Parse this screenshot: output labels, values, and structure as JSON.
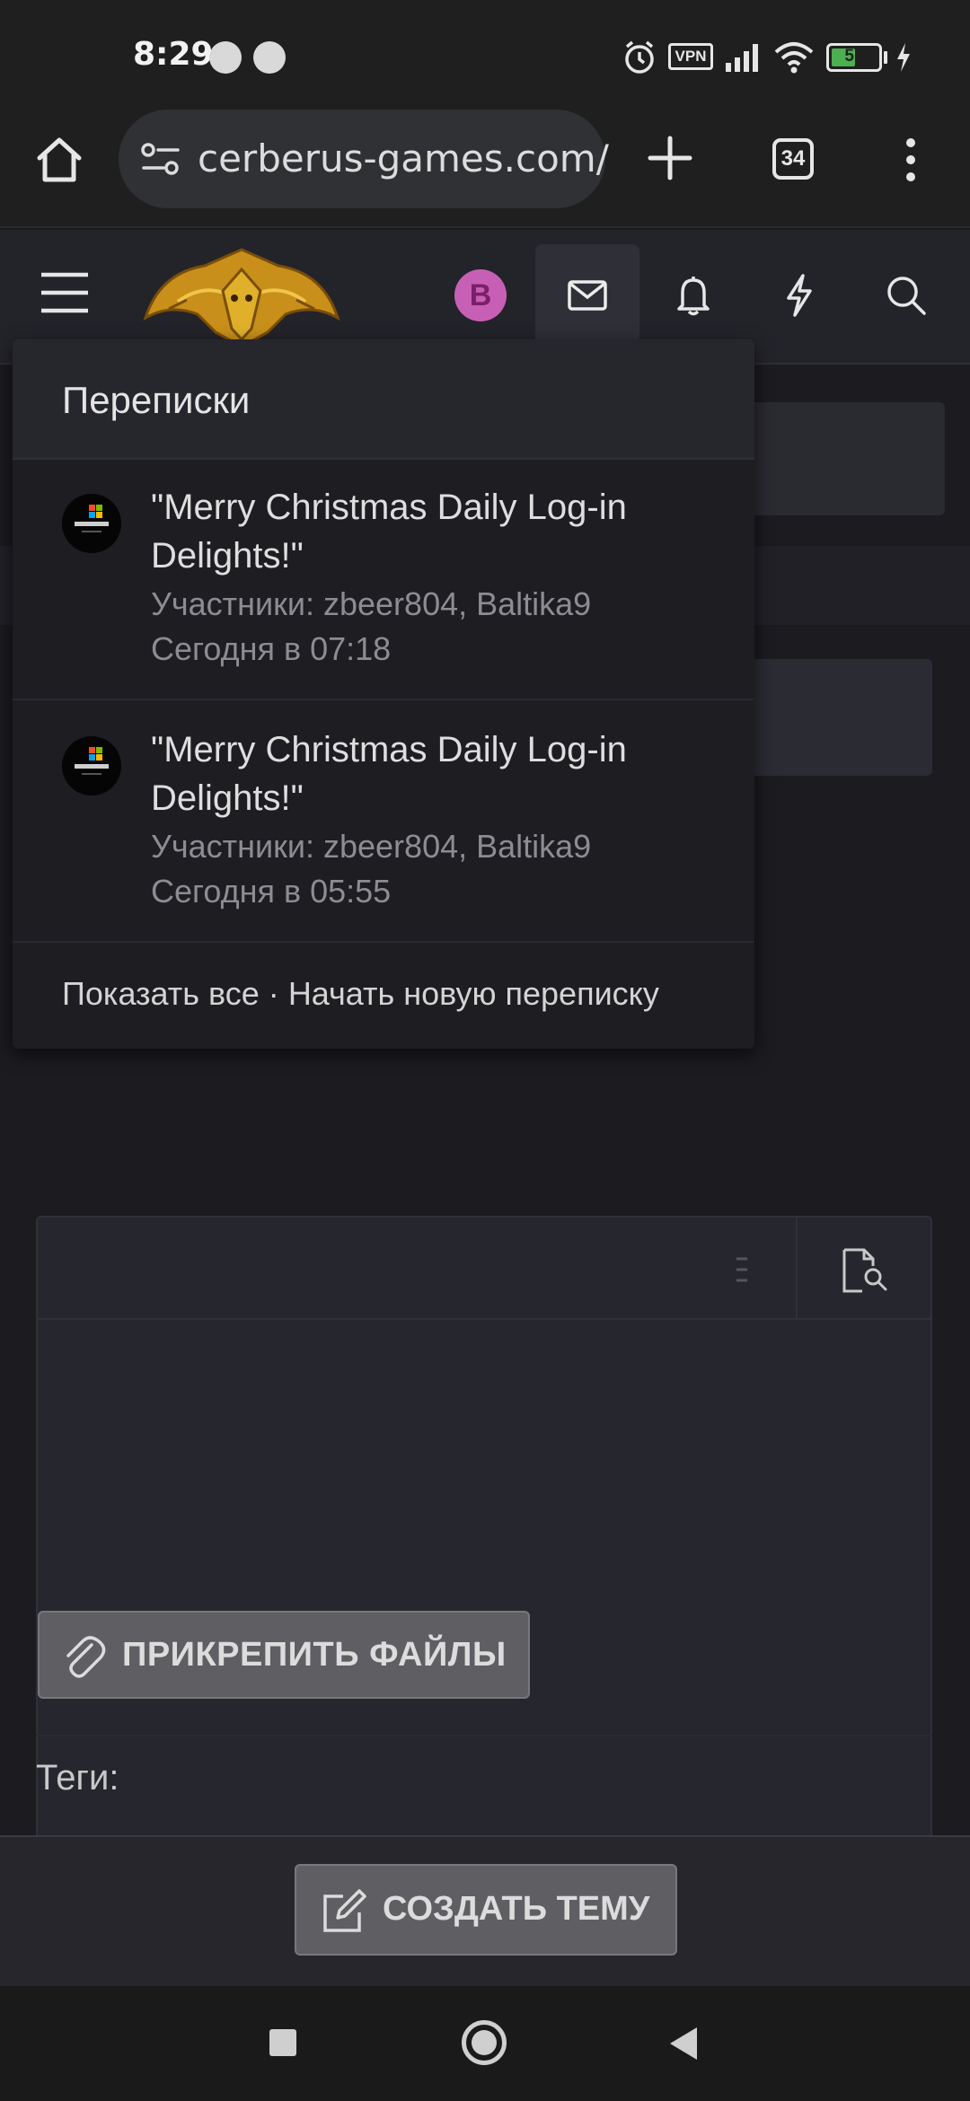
{
  "status_bar": {
    "time": "8:29",
    "icons": [
      "alarm-icon",
      "vpn-icon",
      "signal-icon",
      "wifi-icon",
      "battery-icon",
      "charging-icon"
    ],
    "vpn_label": "VPN",
    "battery_level": "51"
  },
  "browser": {
    "url": "cerberus-games.com/",
    "tab_count": "34"
  },
  "site_header": {
    "avatar_letter": "B",
    "icons": [
      "menu-icon",
      "site-logo",
      "inbox-icon",
      "bell-icon",
      "lightning-icon",
      "search-icon"
    ]
  },
  "conversations": {
    "title": "Переписки",
    "items": [
      {
        "subject": "\"Merry Christmas Daily Log-in Delights!\"",
        "participants": "Участники: zbeer804, Baltika9",
        "time": "Сегодня в 07:18"
      },
      {
        "subject": "\"Merry Christmas Daily Log-in Delights!\"",
        "participants": "Участники: zbeer804, Baltika9",
        "time": "Сегодня в 05:55"
      }
    ],
    "footer": {
      "show_all": "Показать все",
      "separator": "·",
      "new_conversation": "Начать новую переписку"
    }
  },
  "form": {
    "attach_label": "ПРИКРЕПИТЬ ФАЙЛЫ",
    "tags_label": "Теги:",
    "create_label": "СОЗДАТЬ ТЕМУ"
  },
  "colors": {
    "background": "#1b1b20",
    "dropdown": "#1d1d22",
    "button": "#5e5e63",
    "logo_gold": "#d4a017",
    "avatar_pink": "#c760b4"
  }
}
